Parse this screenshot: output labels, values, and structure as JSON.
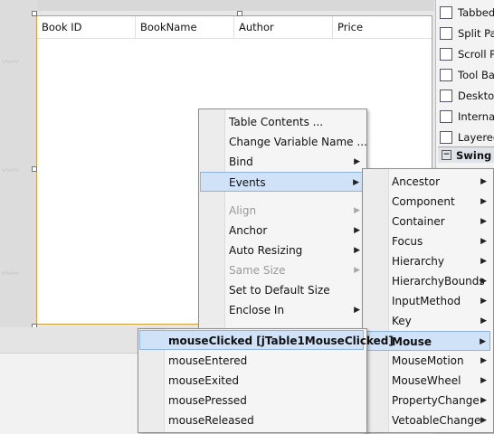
{
  "table": {
    "columns": [
      "Book ID",
      "BookName",
      "Author",
      "Price"
    ]
  },
  "palette": {
    "items": [
      {
        "label": "Tabbed",
        "icon": "tabbed-pane-icon"
      },
      {
        "label": "Split Par",
        "icon": "split-pane-icon"
      },
      {
        "label": "Scroll Pa",
        "icon": "scroll-pane-icon"
      },
      {
        "label": "Tool Bar",
        "icon": "toolbar-icon"
      },
      {
        "label": "Desktop",
        "icon": "desktop-pane-icon"
      },
      {
        "label": "Internal",
        "icon": "internal-frame-icon"
      },
      {
        "label": "Layered",
        "icon": "layered-pane-icon"
      }
    ],
    "category": "Swing C"
  },
  "context_menu": {
    "items": [
      {
        "label": "Table Contents ...",
        "disabled": false,
        "submenu": false
      },
      {
        "label": "Change Variable Name ...",
        "disabled": false,
        "submenu": false
      },
      {
        "label": "Bind",
        "disabled": false,
        "submenu": true
      },
      {
        "label": "Events",
        "disabled": false,
        "submenu": true,
        "selected": true
      },
      {
        "label": "Align",
        "disabled": true,
        "submenu": true
      },
      {
        "label": "Anchor",
        "disabled": false,
        "submenu": true
      },
      {
        "label": "Auto Resizing",
        "disabled": false,
        "submenu": true
      },
      {
        "label": "Same Size",
        "disabled": true,
        "submenu": true
      },
      {
        "label": "Set to Default Size",
        "disabled": false,
        "submenu": false
      },
      {
        "label": "Enclose In",
        "disabled": false,
        "submenu": true
      }
    ]
  },
  "events_menu": {
    "items": [
      "Ancestor",
      "Component",
      "Container",
      "Focus",
      "Hierarchy",
      "HierarchyBounds",
      "InputMethod",
      "Key",
      "Mouse",
      "MouseMotion",
      "MouseWheel",
      "PropertyChange",
      "VetoableChange"
    ],
    "selected": "Mouse"
  },
  "mouse_menu": {
    "items": [
      "mouseClicked [jTable1MouseClicked]",
      "mouseEntered",
      "mouseExited",
      "mousePressed",
      "mouseReleased"
    ]
  }
}
